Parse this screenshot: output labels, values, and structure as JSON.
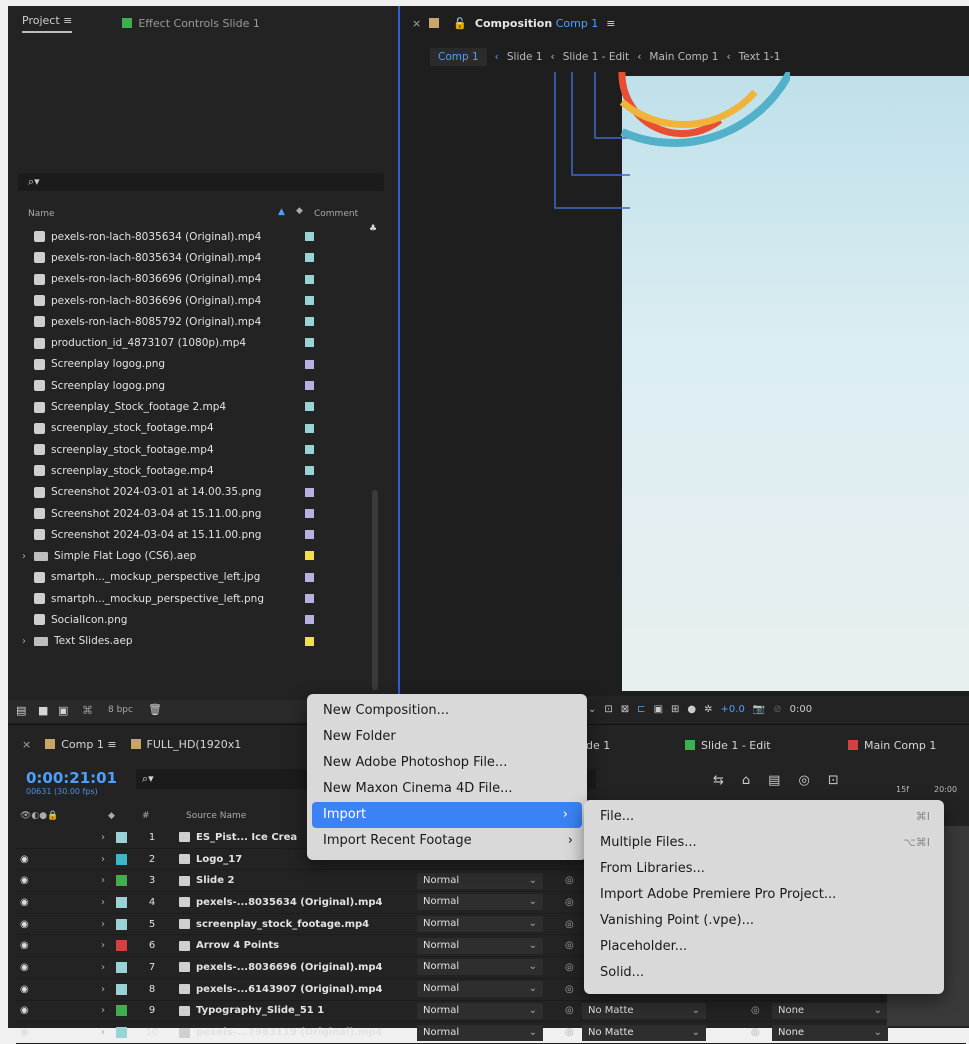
{
  "project_panel": {
    "tab_project": "Project",
    "tab_effect_controls": "Effect Controls Slide 1",
    "col_name": "Name",
    "col_comment": "Comment",
    "files": [
      {
        "name": "pexels-ron-lach-8035634 (Original).mp4",
        "label": "#9ad3d6",
        "folder": false
      },
      {
        "name": "pexels-ron-lach-8035634 (Original).mp4",
        "label": "#9ad3d6",
        "folder": false
      },
      {
        "name": "pexels-ron-lach-8036696 (Original).mp4",
        "label": "#9ad3d6",
        "folder": false
      },
      {
        "name": "pexels-ron-lach-8036696 (Original).mp4",
        "label": "#9ad3d6",
        "folder": false
      },
      {
        "name": "pexels-ron-lach-8085792 (Original).mp4",
        "label": "#9ad3d6",
        "folder": false
      },
      {
        "name": "production_id_4873107 (1080p).mp4",
        "label": "#9ad3d6",
        "folder": false
      },
      {
        "name": "Screenplay logog.png",
        "label": "#b7b1e0",
        "folder": false
      },
      {
        "name": "Screenplay logog.png",
        "label": "#b7b1e0",
        "folder": false
      },
      {
        "name": "Screenplay_Stock_footage 2.mp4",
        "label": "#9ad3d6",
        "folder": false
      },
      {
        "name": "screenplay_stock_footage.mp4",
        "label": "#9ad3d6",
        "folder": false
      },
      {
        "name": "screenplay_stock_footage.mp4",
        "label": "#9ad3d6",
        "folder": false
      },
      {
        "name": "screenplay_stock_footage.mp4",
        "label": "#9ad3d6",
        "folder": false
      },
      {
        "name": "Screenshot 2024-03-01 at 14.00.35.png",
        "label": "#b7b1e0",
        "folder": false
      },
      {
        "name": "Screenshot 2024-03-04 at 15.11.00.png",
        "label": "#b7b1e0",
        "folder": false
      },
      {
        "name": "Screenshot 2024-03-04 at 15.11.00.png",
        "label": "#b7b1e0",
        "folder": false
      },
      {
        "name": "Simple Flat Logo (CS6).aep",
        "label": "#f2e04a",
        "folder": true
      },
      {
        "name": "smartph..._mockup_perspective_left.jpg",
        "label": "#b7b1e0",
        "folder": false
      },
      {
        "name": "smartph..._mockup_perspective_left.png",
        "label": "#b7b1e0",
        "folder": false
      },
      {
        "name": "SocialIcon.png",
        "label": "#b7b1e0",
        "folder": false
      },
      {
        "name": "Text Slides.aep",
        "label": "#f2e04a",
        "folder": true
      }
    ],
    "bpc": "8 bpc"
  },
  "composition": {
    "tab_prefix": "Composition",
    "tab_comp": "Comp 1",
    "breadcrumbs": [
      "Comp 1",
      "Slide 1",
      "Slide 1 - Edit",
      "Main Comp 1",
      "Text 1-1"
    ],
    "exposure": "+0.0",
    "time": "0:00"
  },
  "timeline": {
    "tab_comp": "Comp 1",
    "tab_fullhd": "FULL_HD(1920x1",
    "tab_slide1": "ide 1",
    "tab_slide1_edit": "Slide 1 - Edit",
    "tab_main": "Main Comp 1",
    "timecode": "0:00:21:01",
    "fps": "00631 (30.00 fps)",
    "col_source": "Source Name",
    "ruler_a": "15f",
    "ruler_b": "20:00",
    "layers": [
      {
        "num": "1",
        "name": "ES_Pist... Ice Crea",
        "label": "#9ad3d6",
        "mode": "",
        "matte": "",
        "parent": ""
      },
      {
        "num": "2",
        "name": "Logo_17",
        "label": "#3fb6c7",
        "mode": "",
        "matte": "",
        "parent": ""
      },
      {
        "num": "3",
        "name": "Slide 2",
        "label": "#3fae4f",
        "mode": "Normal",
        "matte": "",
        "parent": ""
      },
      {
        "num": "4",
        "name": "pexels-...8035634 (Original).mp4",
        "label": "#9ad3d6",
        "mode": "Normal",
        "matte": "",
        "parent": ""
      },
      {
        "num": "5",
        "name": "screenplay_stock_footage.mp4",
        "label": "#9ad3d6",
        "mode": "Normal",
        "matte": "",
        "parent": ""
      },
      {
        "num": "6",
        "name": "Arrow 4 Points",
        "label": "#d64040",
        "mode": "Normal",
        "matte": "",
        "parent": ""
      },
      {
        "num": "7",
        "name": "pexels-...8036696 (Original).mp4",
        "label": "#9ad3d6",
        "mode": "Normal",
        "matte": "",
        "parent": ""
      },
      {
        "num": "8",
        "name": "pexels-...6143907 (Original).mp4",
        "label": "#9ad3d6",
        "mode": "Normal",
        "matte": "",
        "parent": ""
      },
      {
        "num": "9",
        "name": "Typography_Slide_51 1",
        "label": "#3fae4f",
        "mode": "Normal",
        "matte": "No Matte",
        "parent": "None"
      },
      {
        "num": "10",
        "name": "pexels-...7983119 (Original).mp4",
        "label": "#9ad3d6",
        "mode": "Normal",
        "matte": "No Matte",
        "parent": "None"
      }
    ]
  },
  "context_menu": {
    "items": [
      {
        "label": "New Composition...",
        "submenu": false,
        "highlighted": false
      },
      {
        "label": "New Folder",
        "submenu": false,
        "highlighted": false
      },
      {
        "label": "New Adobe Photoshop File...",
        "submenu": false,
        "highlighted": false
      },
      {
        "label": "New Maxon Cinema 4D File...",
        "submenu": false,
        "highlighted": false
      },
      {
        "label": "Import",
        "submenu": true,
        "highlighted": true
      },
      {
        "label": "Import Recent Footage",
        "submenu": true,
        "highlighted": false
      }
    ],
    "submenu": [
      {
        "label": "File...",
        "shortcut": "⌘I"
      },
      {
        "label": "Multiple Files...",
        "shortcut": "⌥⌘I"
      },
      {
        "label": "From Libraries...",
        "shortcut": ""
      },
      {
        "label": "Import Adobe Premiere Pro Project...",
        "shortcut": ""
      },
      {
        "label": "Vanishing Point (.vpe)...",
        "shortcut": ""
      },
      {
        "label": "Placeholder...",
        "shortcut": ""
      },
      {
        "label": "Solid...",
        "shortcut": ""
      }
    ]
  },
  "colors": {
    "accent": "#3b82f6",
    "timecode": "#4ea0ff",
    "panel": "#232323"
  }
}
